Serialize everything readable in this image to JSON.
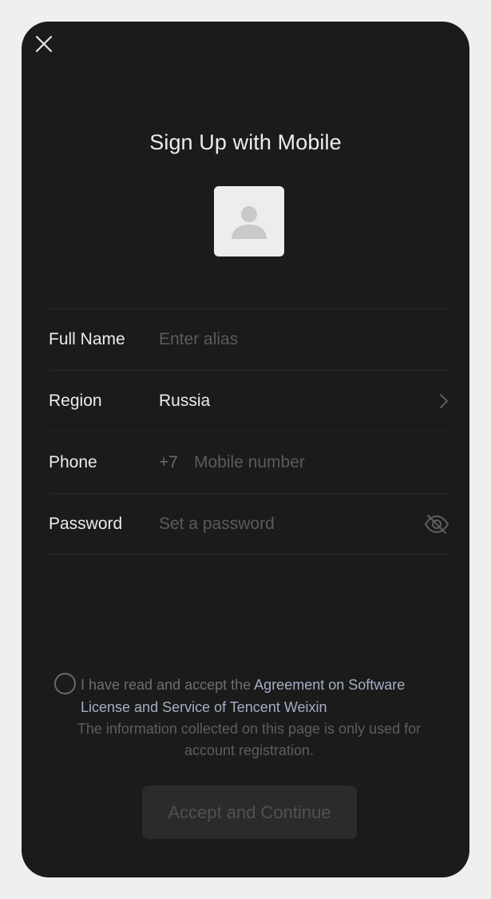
{
  "title": "Sign Up with Mobile",
  "icons": {
    "close": "close-icon",
    "avatar": "person-placeholder-icon",
    "chevron": "chevron-right-icon",
    "visibility": "eye-off-icon"
  },
  "form": {
    "full_name": {
      "label": "Full Name",
      "placeholder": "Enter alias",
      "value": ""
    },
    "region": {
      "label": "Region",
      "value": "Russia"
    },
    "phone": {
      "label": "Phone",
      "country_code": "+7",
      "placeholder": "Mobile number",
      "value": ""
    },
    "password": {
      "label": "Password",
      "placeholder": "Set a password",
      "value": ""
    }
  },
  "consent": {
    "prefix": "I have read and accept the ",
    "link": "Agreement on Software License and Service of Tencent Weixin",
    "checked": false
  },
  "note": "The information collected on this page is only used for account registration.",
  "button": {
    "label": "Accept and Continue",
    "enabled": false
  },
  "colors": {
    "background": "#1b1b1b",
    "frame": "#efefef",
    "text": "#ececec",
    "placeholder": "#5b5b5b",
    "link": "#a6adc4",
    "button_bg": "#2b2b2b",
    "button_text": "#505050"
  }
}
